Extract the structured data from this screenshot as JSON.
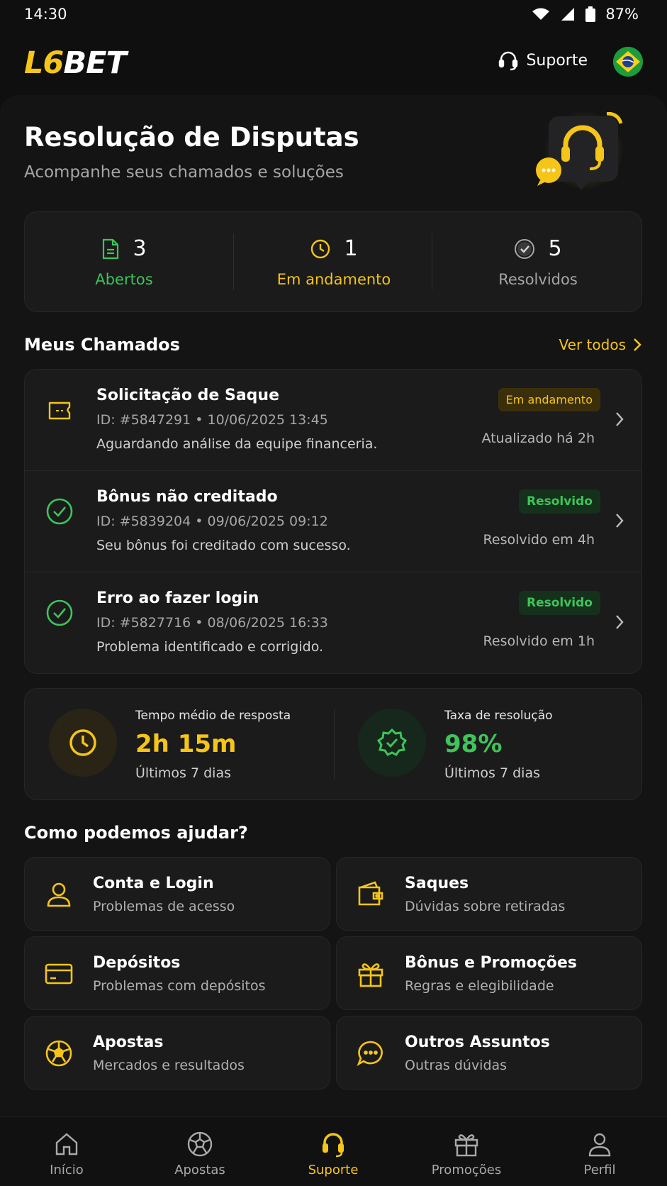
{
  "status_bar": {
    "time": "14:30",
    "battery": "87%"
  },
  "header": {
    "logo_prefix": "L6",
    "logo_suffix": "BET",
    "support_label": "Suporte",
    "flag": "brazil-flag"
  },
  "hero": {
    "title": "Resolução de Disputas",
    "subtitle": "Acompanhe seus chamados e soluções"
  },
  "stats": [
    {
      "count": "3",
      "label": "Abertos",
      "color": "#3ec45a",
      "icon": "document-icon"
    },
    {
      "count": "1",
      "label": "Em andamento",
      "color": "#f5c518",
      "icon": "clock-icon"
    },
    {
      "count": "5",
      "label": "Resolvidos",
      "color": "#a6a6a6",
      "icon": "check-circle-icon"
    }
  ],
  "tickets_section": {
    "title": "Meus Chamados",
    "see_all": "Ver todos"
  },
  "tickets": [
    {
      "title": "Solicitação de Saque",
      "meta": "ID: #5847291 • 10/06/2025 13:45",
      "desc": "Aguardando análise da equipe financeria.",
      "badge": "Em andamento",
      "updated": "Atualizado há 2h",
      "icon": "wallet-icon"
    },
    {
      "title": "Bônus não creditado",
      "meta": "ID: #5839204 • 09/06/2025 09:12",
      "desc": "Seu bônus foi creditado com sucesso.",
      "badge": "Resolvido",
      "updated": "Resolvido em 4h",
      "icon": "check-circle-icon"
    },
    {
      "title": "Erro ao fazer login",
      "meta": "ID: #5827716 • 08/06/2025 16:33",
      "desc": "Problema identificado e corrigido.",
      "badge": "Resolvido",
      "updated": "Resolvido em 1h",
      "icon": "check-circle-icon"
    }
  ],
  "metrics": [
    {
      "label": "Tempo médio de resposta",
      "value": "2h 15m",
      "sub": "Últimos 7 dias",
      "color": "#f5c518"
    },
    {
      "label": "Taxa de resolução",
      "value": "98%",
      "sub": "Últimos 7 dias",
      "color": "#3ec45a"
    }
  ],
  "help_section": {
    "title": "Como podemos ajudar?"
  },
  "help_items": [
    {
      "title": "Conta e Login",
      "sub": "Problemas de acesso",
      "icon": "user-icon"
    },
    {
      "title": "Saques",
      "sub": "Dúvidas sobre retiradas",
      "icon": "wallet-icon"
    },
    {
      "title": "Depósitos",
      "sub": "Problemas com depósitos",
      "icon": "credit-card-icon"
    },
    {
      "title": "Bônus e Promoções",
      "sub": "Regras e elegibilidade",
      "icon": "gift-icon"
    },
    {
      "title": "Apostas",
      "sub": "Mercados e resultados",
      "icon": "soccer-ball-icon"
    },
    {
      "title": "Outros Assuntos",
      "sub": "Outras dúvidas",
      "icon": "chat-bubble-icon"
    }
  ],
  "bottom_nav": [
    {
      "label": "Início",
      "icon": "home-icon"
    },
    {
      "label": "Apostas",
      "icon": "soccer-ball-icon"
    },
    {
      "label": "Suporte",
      "icon": "headset-icon",
      "active": true
    },
    {
      "label": "Promoções",
      "icon": "gift-icon"
    },
    {
      "label": "Perfil",
      "icon": "user-icon"
    }
  ],
  "colors": {
    "accent": "#f5c518",
    "success": "#3ec45a",
    "background": "#0f0f10",
    "card": "#1b1b1c"
  }
}
